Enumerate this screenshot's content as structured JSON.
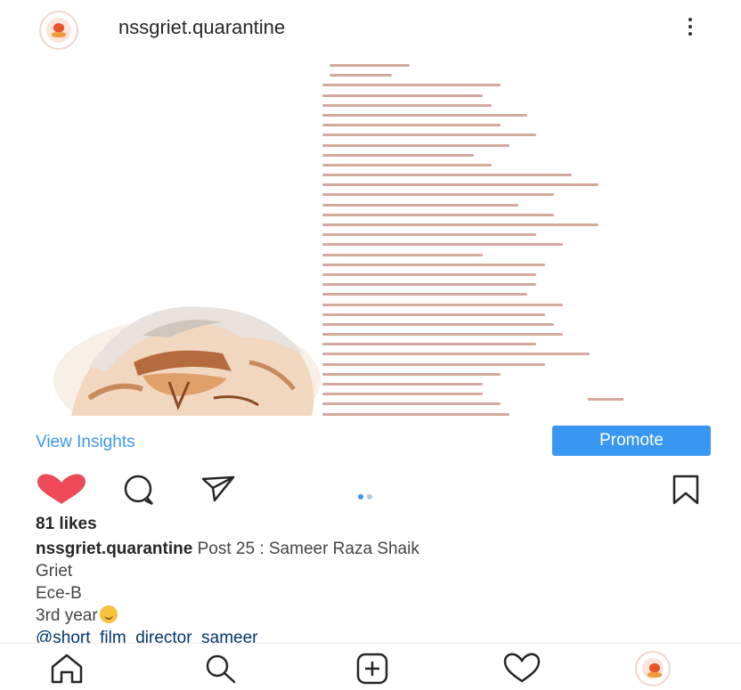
{
  "header": {
    "username": "nssgriet.quarantine",
    "avatar_icon": "profile-avatar",
    "more_icon": "more-vertical-icon"
  },
  "post": {
    "image": "poem-with-portrait"
  },
  "insights": {
    "view_insights_label": "View Insights",
    "promote_label": "Promote",
    "accent_color": "#3897f0"
  },
  "actions": {
    "like_icon": "heart-filled-icon",
    "like_color": "#ed4956",
    "comment_icon": "comment-icon",
    "share_icon": "share-icon",
    "save_icon": "bookmark-icon",
    "carousel_current": 1,
    "carousel_total": 2
  },
  "likes": "81 likes",
  "caption": {
    "username": "nssgriet.quarantine",
    "text": "Post 25 : Sameer Raza Shaik",
    "line2": "Griet",
    "line3": "Ece-B",
    "line4": "3rd year",
    "mention": "@short_film_director_sameer"
  },
  "bottom_nav": {
    "items": [
      "home-icon",
      "search-icon",
      "add-post-icon",
      "activity-heart-icon",
      "profile-avatar"
    ]
  }
}
